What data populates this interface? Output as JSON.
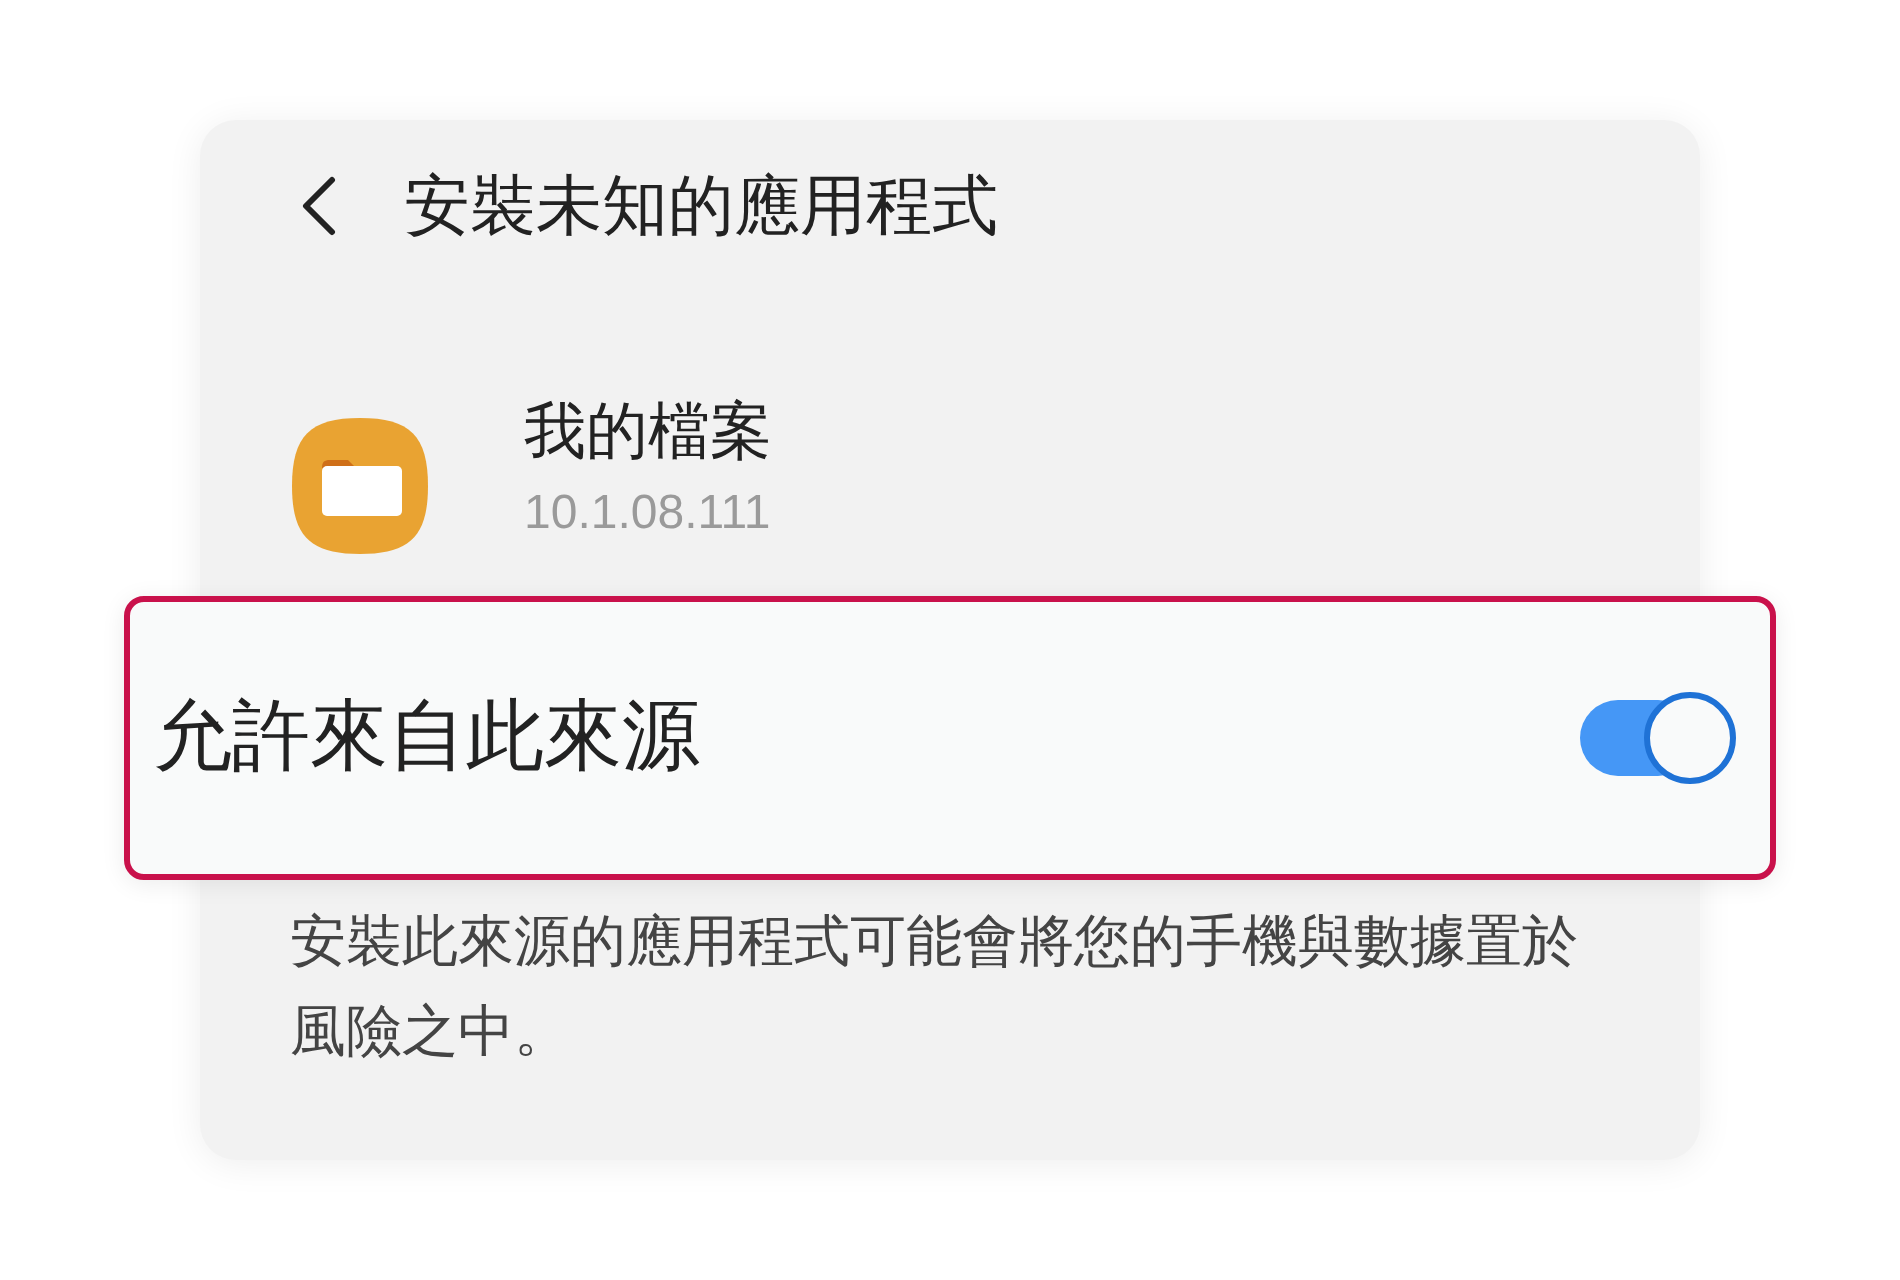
{
  "header": {
    "title": "安裝未知的應用程式"
  },
  "app": {
    "name": "我的檔案",
    "version": "10.1.08.111"
  },
  "allow_setting": {
    "label": "允許來自此來源",
    "on": true,
    "highlighted": true
  },
  "description": "安裝此來源的應用程式可能會將您的手機與數據置於風險之中。"
}
